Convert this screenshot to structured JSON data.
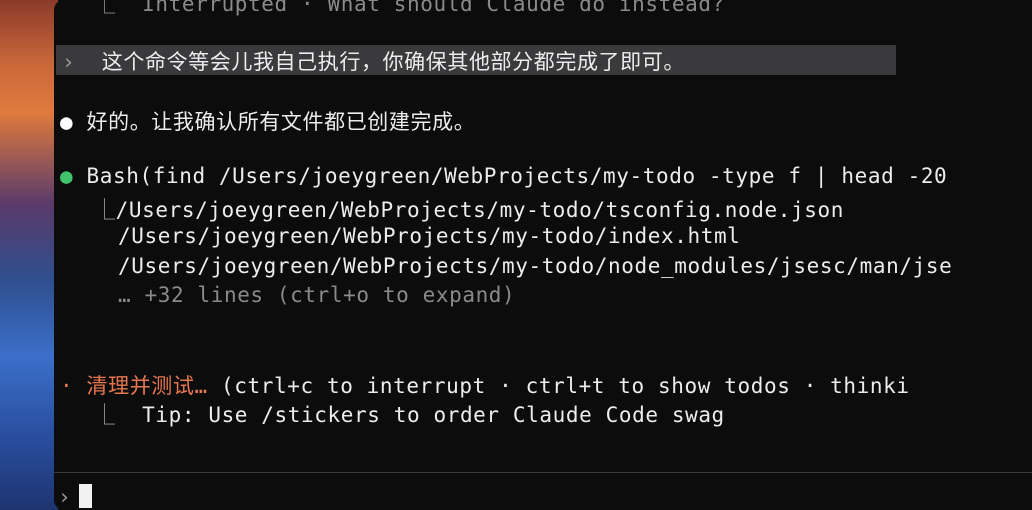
{
  "history": {
    "interrupted_prefix": "⎿",
    "interrupted_text": "Interrupted · What should Claude do instead?"
  },
  "user_message": {
    "prompt_glyph": "›",
    "text": "这个命令等会儿我自己执行，你确保其他部分都完成了即可。"
  },
  "assistant": {
    "bullet": "●",
    "text": "好的。让我确认所有文件都已创建完成。"
  },
  "tool_call": {
    "bullet": "●",
    "command": "Bash(find /Users/joeygreen/WebProjects/my-todo -type f | head -20",
    "result_prefix": "⎿",
    "results": [
      "/Users/joeygreen/WebProjects/my-todo/tsconfig.node.json",
      "/Users/joeygreen/WebProjects/my-todo/index.html",
      "/Users/joeygreen/WebProjects/my-todo/node_modules/jsesc/man/jse"
    ],
    "more": "… +32 lines (ctrl+o to expand)"
  },
  "status": {
    "bullet": "·",
    "activity": "清理并测试…",
    "hints": "(ctrl+c to interrupt · ctrl+t to show todos · thinki",
    "tip_prefix": "⎿",
    "tip": "Tip: Use /stickers to order Claude Code swag"
  },
  "input": {
    "prompt_glyph": "›",
    "value": ""
  },
  "colors": {
    "accent_orange": "#e8774f",
    "success_green": "#3fc46a",
    "background": "#0c0c0d"
  }
}
